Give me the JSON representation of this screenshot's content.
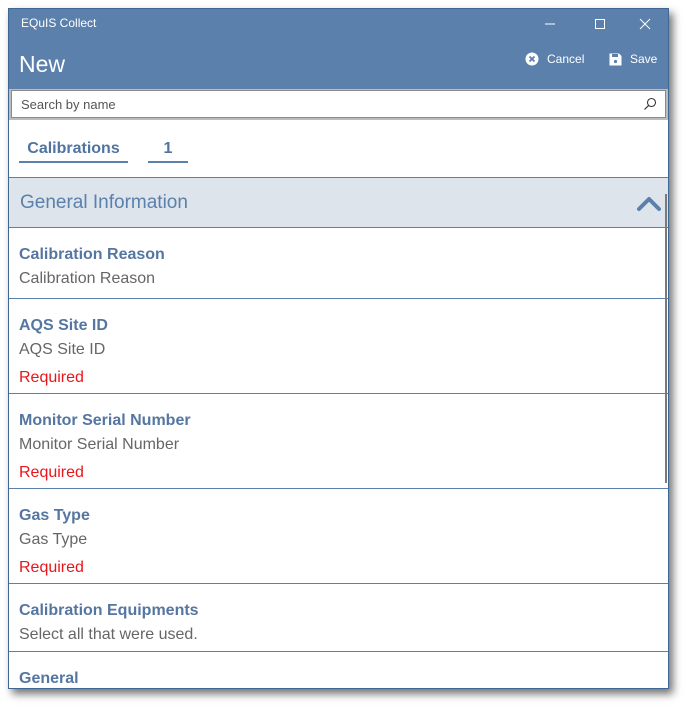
{
  "window": {
    "app_title": "EQuIS Collect",
    "controls": {
      "minimize_icon": "minimize-icon",
      "maximize_icon": "maximize-icon",
      "close_icon": "close-icon"
    }
  },
  "header": {
    "title": "New",
    "actions": {
      "cancel": {
        "label": "Cancel",
        "icon": "cancel-circle-icon"
      },
      "save": {
        "label": "Save",
        "icon": "save-disk-icon"
      }
    }
  },
  "search": {
    "placeholder": "Search by name",
    "value": "",
    "icon": "search-icon"
  },
  "tabs": [
    {
      "label": "Calibrations"
    },
    {
      "label": "1"
    }
  ],
  "section": {
    "title": "General Information",
    "expanded": true,
    "icon": "chevron-up-icon"
  },
  "fields": [
    {
      "label": "Calibration Reason",
      "hint": "Calibration Reason",
      "required": null
    },
    {
      "label": "AQS Site ID",
      "hint": "AQS Site ID",
      "required": "Required"
    },
    {
      "label": "Monitor Serial Number",
      "hint": "Monitor Serial Number",
      "required": "Required"
    },
    {
      "label": "Gas Type",
      "hint": "Gas Type",
      "required": "Required"
    },
    {
      "label": "Calibration Equipments",
      "hint": "Select all that were used.",
      "required": null
    },
    {
      "label": "General",
      "hint": null,
      "required": null
    }
  ],
  "colors": {
    "header_bg": "#5b80ab",
    "section_bg": "#dde4ec",
    "label": "#5576a0",
    "required": "#e8151b"
  }
}
